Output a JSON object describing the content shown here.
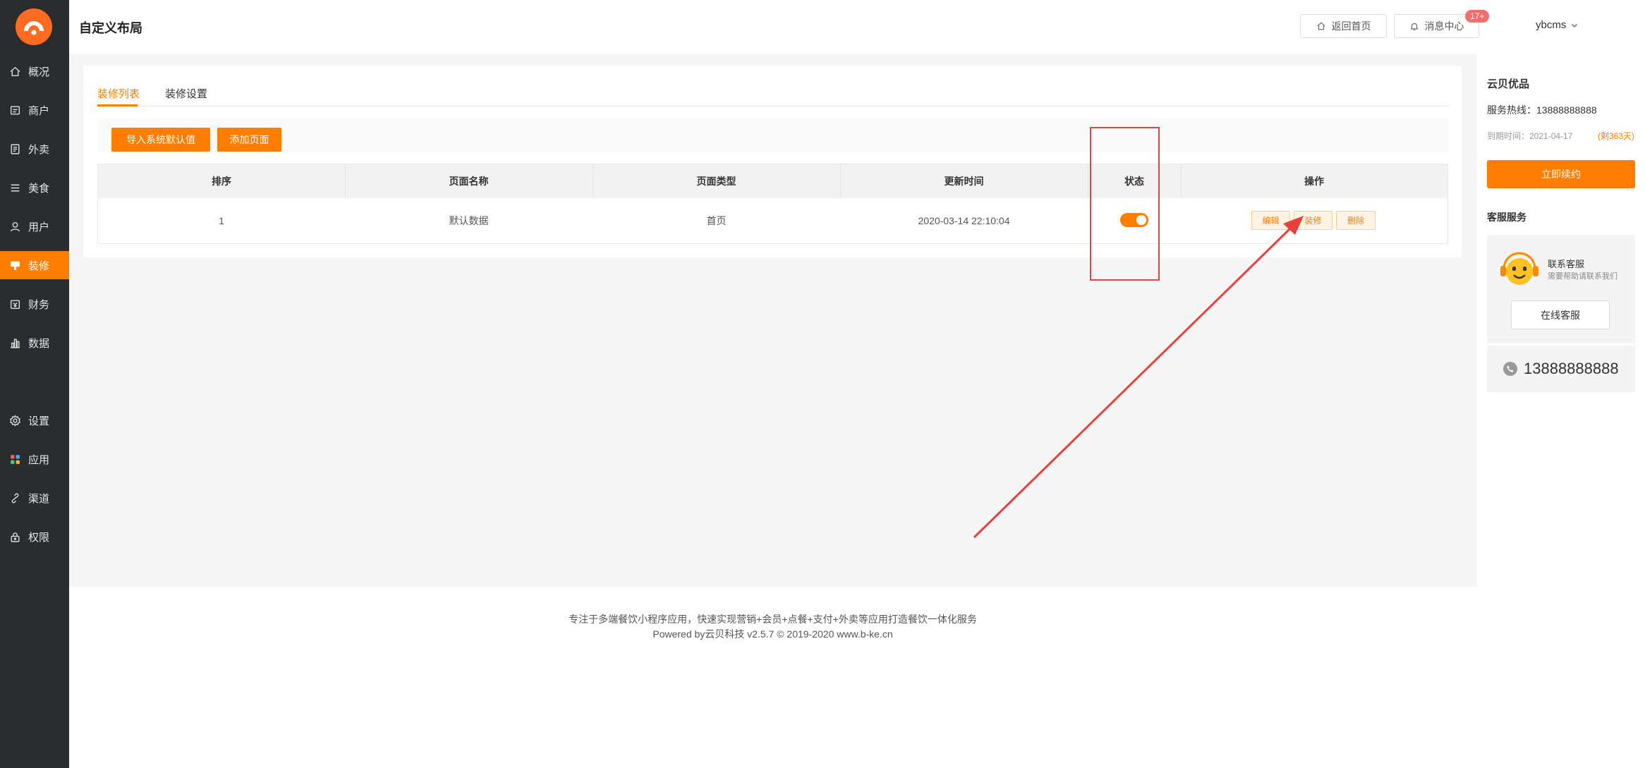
{
  "header": {
    "title": "自定义布局",
    "home_button": "返回首页",
    "messages_button": "消息中心",
    "messages_badge": "17+",
    "user": "ybcms"
  },
  "sidebar": {
    "items": [
      {
        "label": "概况",
        "icon": "home-icon"
      },
      {
        "label": "商户",
        "icon": "store-icon"
      },
      {
        "label": "外卖",
        "icon": "takeout-icon"
      },
      {
        "label": "美食",
        "icon": "menu-icon"
      },
      {
        "label": "用户",
        "icon": "user-icon"
      },
      {
        "label": "装修",
        "icon": "decoration-icon",
        "active": true
      },
      {
        "label": "财务",
        "icon": "finance-icon"
      },
      {
        "label": "数据",
        "icon": "data-icon"
      },
      {
        "label": "设置",
        "icon": "gear-icon"
      },
      {
        "label": "应用",
        "icon": "apps-icon"
      },
      {
        "label": "渠道",
        "icon": "link-icon"
      },
      {
        "label": "权限",
        "icon": "lock-icon"
      }
    ]
  },
  "tabs": [
    {
      "label": "装修列表",
      "active": true
    },
    {
      "label": "装修设置"
    }
  ],
  "toolbar": {
    "import_default": "导入系统默认值",
    "add_page": "添加页面"
  },
  "table": {
    "columns": [
      "排序",
      "页面名称",
      "页面类型",
      "更新时间",
      "状态",
      "操作"
    ],
    "rows": [
      {
        "order": "1",
        "name": "默认数据",
        "type": "首页",
        "updated": "2020-03-14 22:10:04",
        "status_on": true,
        "actions": [
          "编辑",
          "装修",
          "删除"
        ]
      }
    ]
  },
  "footer": {
    "line1": "专注于多端餐饮小程序应用，快速实现营销+会员+点餐+支付+外卖等应用打造餐饮一体化服务",
    "line2": "Powered by云贝科技 v2.5.7 © 2019-2020 www.b-ke.cn"
  },
  "right_panel": {
    "brand": "云贝优品",
    "hotline": "服务热线：13888888888",
    "expiry": "到期时间：2021-04-17",
    "remaining": "(剩363天)",
    "renew_button": "立即续约",
    "service_title": "客服服务",
    "contact_title": "联系客服",
    "contact_sub": "需要帮助请联系我们",
    "online_button": "在线客服",
    "phone": "13888888888"
  },
  "colors": {
    "accent": "#ff7d00",
    "sidebar_bg": "#2b2c2d",
    "annotation_red": "#e8413c"
  }
}
